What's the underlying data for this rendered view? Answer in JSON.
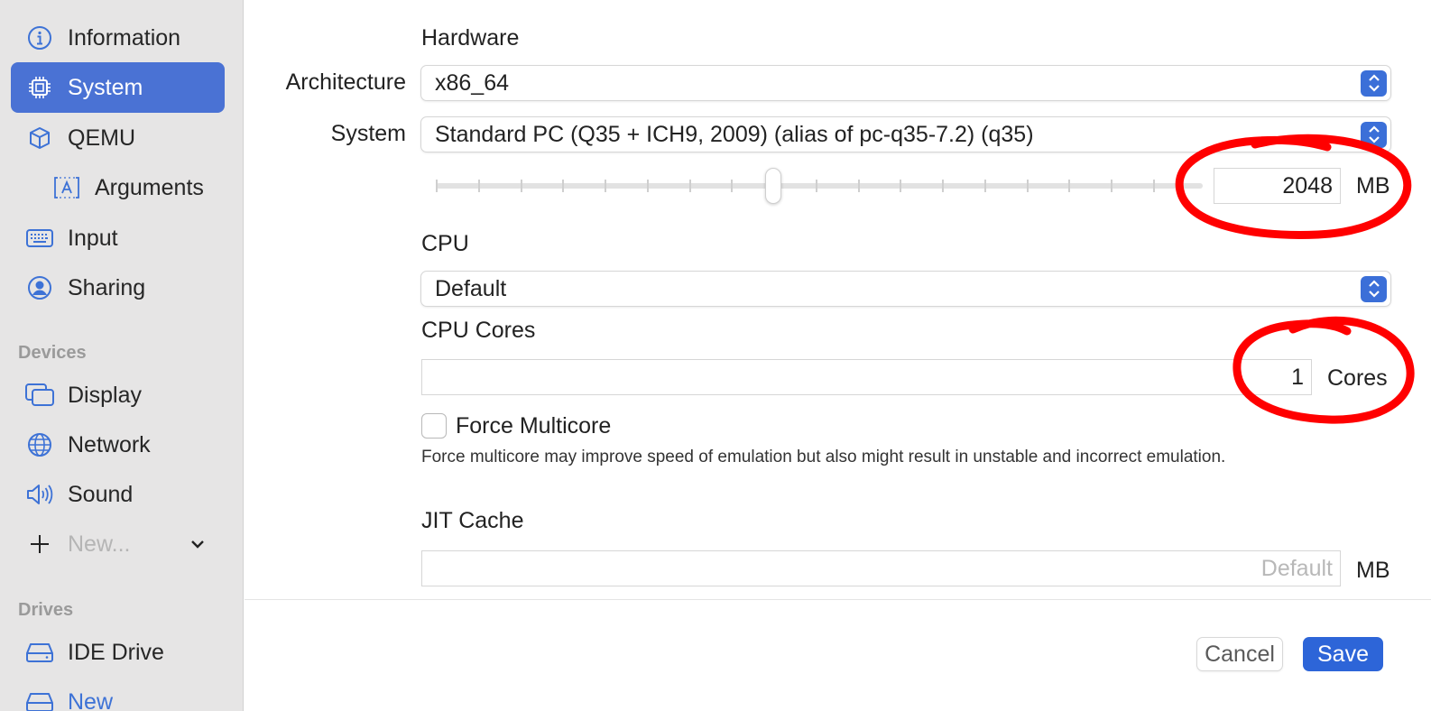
{
  "sidebar": {
    "items": [
      {
        "label": "Information",
        "icon": "info-circle-icon"
      },
      {
        "label": "System",
        "icon": "cpu-chip-icon",
        "active": true
      },
      {
        "label": "QEMU",
        "icon": "cube-icon"
      },
      {
        "label": "Arguments",
        "icon": "text-box-a-icon"
      },
      {
        "label": "Input",
        "icon": "keyboard-icon"
      },
      {
        "label": "Sharing",
        "icon": "person-circle-icon"
      }
    ],
    "devices_header": "Devices",
    "devices": [
      {
        "label": "Display",
        "icon": "display-windows-icon"
      },
      {
        "label": "Network",
        "icon": "globe-icon"
      },
      {
        "label": "Sound",
        "icon": "speaker-icon"
      }
    ],
    "new_label": "New...",
    "drives_header": "Drives",
    "drives": [
      {
        "label": "IDE Drive",
        "icon": "drive-icon"
      },
      {
        "label": "New",
        "icon": "drive-icon"
      }
    ],
    "accent": "#4a72d4"
  },
  "main": {
    "hardware_header": "Hardware",
    "architecture_label": "Architecture",
    "architecture_value": "x86_64",
    "system_label": "System",
    "system_value": "Standard PC (Q35 + ICH9, 2009) (alias of pc-q35-7.2) (q35)",
    "memory_value": "2048",
    "memory_unit": "MB",
    "memory_slider_level": 0.44,
    "cpu_header": "CPU",
    "cpu_value": "Default",
    "cores_header": "CPU Cores",
    "cores_value": "1",
    "cores_unit": "Cores",
    "force_multicore_label": "Force Multicore",
    "force_multicore_checked": false,
    "force_multicore_help": "Force multicore may improve speed of emulation but also might result in unstable and incorrect emulation.",
    "jit_header": "JIT Cache",
    "jit_placeholder": "Default",
    "jit_unit": "MB"
  },
  "footer": {
    "cancel_label": "Cancel",
    "save_label": "Save"
  },
  "colors": {
    "annotation": "#ff0000",
    "primary_button": "#2d65d8"
  }
}
